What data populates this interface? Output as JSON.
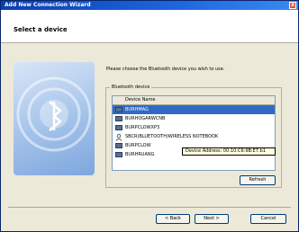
{
  "window": {
    "title": "Add New Connection Wizard",
    "close_glyph": "x"
  },
  "header": {
    "title": "Select a device"
  },
  "instructions": "Please choose the Bluetooth device you wish to use.",
  "group": {
    "label": "Bluetooth device",
    "list_header": "Device Name",
    "devices": [
      {
        "name": "BURHMAG",
        "icon": "computer-icon",
        "selected": true
      },
      {
        "name": "BURHOGARWCNB",
        "icon": "computer-icon",
        "selected": false
      },
      {
        "name": "BURPCLOWXP3",
        "icon": "computer-icon",
        "selected": false
      },
      {
        "name": "SBCR(BLUETOOTH)WIRELESS NOTEBOOK",
        "icon": "person-icon",
        "selected": false
      },
      {
        "name": "BURPCLOW",
        "icon": "computer-icon",
        "selected": false
      },
      {
        "name": "BURHRUANG",
        "icon": "computer-icon",
        "selected": false
      }
    ],
    "tooltip": "Device Address: 00:10:C6:9B:E7:b1",
    "refresh_label": "Refresh"
  },
  "buttons": {
    "back": "< Back",
    "next": "Next >",
    "cancel": "Cancel"
  },
  "colors": {
    "titlebar": "#1f66e0",
    "selection": "#316ac5",
    "side_graphic": "#9fbfe8"
  }
}
